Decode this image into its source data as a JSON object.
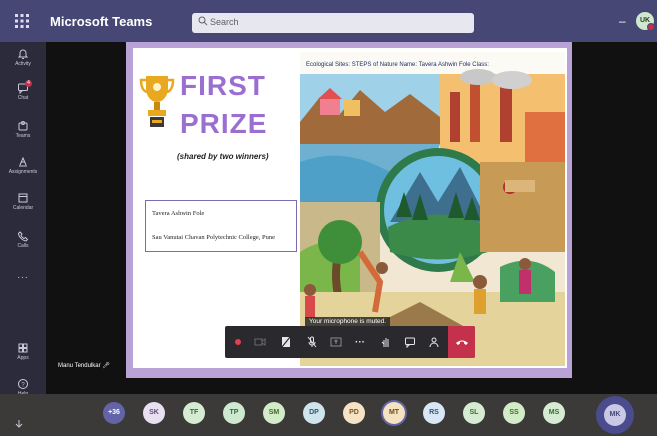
{
  "app": {
    "title": "Microsoft Teams",
    "search_placeholder": "Search",
    "account_initials": "UK"
  },
  "rail": [
    {
      "label": "Activity",
      "icon": "bell-icon"
    },
    {
      "label": "Chat",
      "icon": "chat-icon",
      "badge": "4"
    },
    {
      "label": "Teams",
      "icon": "teams-icon"
    },
    {
      "label": "Assignments",
      "icon": "assignments-icon"
    },
    {
      "label": "Calendar",
      "icon": "calendar-icon"
    },
    {
      "label": "Calls",
      "icon": "phone-icon"
    },
    {
      "label": "...",
      "icon": "more-icon"
    },
    {
      "label": "Apps",
      "icon": "apps-icon"
    },
    {
      "label": "Help",
      "icon": "help-icon"
    }
  ],
  "slide": {
    "title_line1": "FIRST",
    "title_line2": "PRIZE",
    "subtitle": "(shared by two winners)",
    "winner_name": "Tavera Ashwin Fole",
    "winner_college": "Sau Vanutai Chavan Polytechnic College, Pune",
    "painting_caption": "Ecological Sites: STEPS of Nature Name: Tavera Ashwin Fole Class:"
  },
  "call": {
    "muted_message": "Your microphone is muted.",
    "self_name": "Manu Tendulkar",
    "controls": [
      "record-dot-icon",
      "video-off-icon",
      "share-icon",
      "mic-off-icon",
      "share-tray-icon",
      "more-icon",
      "raise-hand-icon",
      "chat-icon",
      "participants-icon",
      "hang-up-icon"
    ]
  },
  "participants": {
    "overflow": "+36",
    "list": [
      {
        "initials": "SK",
        "bg": "#e8e0f0",
        "fg": "#5c4a7a"
      },
      {
        "initials": "TF",
        "bg": "#d6ecd2",
        "fg": "#3a6b32"
      },
      {
        "initials": "TP",
        "bg": "#cfe8d0",
        "fg": "#2f6b3f"
      },
      {
        "initials": "SM",
        "bg": "#d3ecc8",
        "fg": "#3f6b2a"
      },
      {
        "initials": "DP",
        "bg": "#cfe4ec",
        "fg": "#2d5a6b"
      },
      {
        "initials": "PD",
        "bg": "#f6e3c6",
        "fg": "#7a5520"
      },
      {
        "initials": "MT",
        "bg": "#f5e2c0",
        "fg": "#6b4a1e"
      },
      {
        "initials": "RS",
        "bg": "#d9e6f5",
        "fg": "#34507a"
      },
      {
        "initials": "SL",
        "bg": "#d6ecd2",
        "fg": "#3a6b32"
      },
      {
        "initials": "SS",
        "bg": "#d3ecc8",
        "fg": "#3f6b2a"
      },
      {
        "initials": "MS",
        "bg": "#d6ecd2",
        "fg": "#3a6b32"
      }
    ],
    "self": "MK"
  },
  "colors": {
    "titlebar": "#464775",
    "hangup": "#c4314b",
    "accent": "#6264a7",
    "slide_title": "#9b6fd0"
  }
}
